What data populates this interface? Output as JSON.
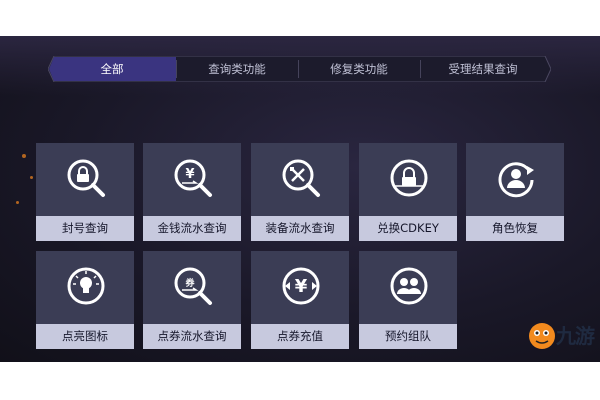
{
  "tabs": [
    {
      "label": "全部",
      "active": true
    },
    {
      "label": "查询类功能",
      "active": false
    },
    {
      "label": "修复类功能",
      "active": false
    },
    {
      "label": "受理结果查询",
      "active": false
    }
  ],
  "tiles": [
    {
      "label": "封号查询",
      "icon": "lock-search-icon"
    },
    {
      "label": "金钱流水查询",
      "icon": "yen-exchange-icon"
    },
    {
      "label": "装备流水查询",
      "icon": "equipment-search-icon"
    },
    {
      "label": "兑换CDKEY",
      "icon": "lock-code-icon"
    },
    {
      "label": "角色恢复",
      "icon": "user-restore-icon"
    },
    {
      "label": "点亮图标",
      "icon": "lightbulb-icon"
    },
    {
      "label": "点券流水查询",
      "icon": "coupon-search-icon"
    },
    {
      "label": "点券充值",
      "icon": "yen-recharge-icon"
    },
    {
      "label": "预约组队",
      "icon": "team-icon"
    }
  ],
  "watermark": {
    "text": "九游"
  },
  "colors": {
    "tile_bg": "#3b3d55",
    "label_bg": "#c7c9de",
    "active_tab": "#3a3480"
  }
}
